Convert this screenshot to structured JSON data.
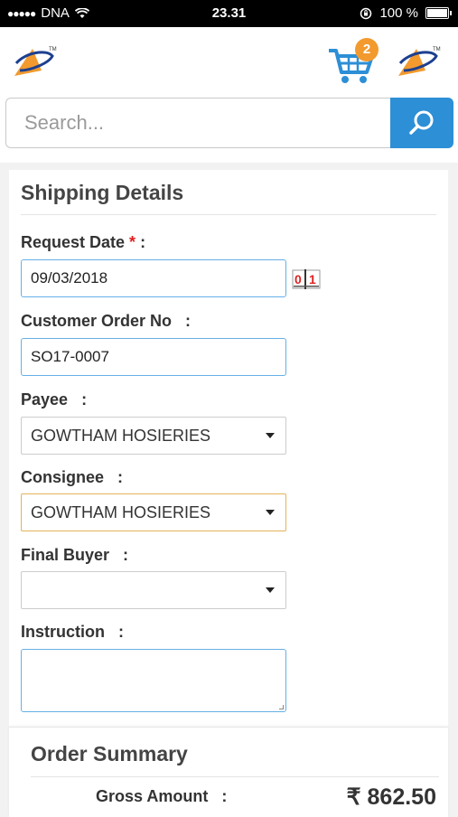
{
  "status_bar": {
    "carrier": "DNA",
    "time": "23.31",
    "battery": "100 %",
    "signal_icon": "signal-dots-icon",
    "wifi_icon": "wifi-icon",
    "lock_icon": "orientation-lock-icon",
    "battery_level": 1.0
  },
  "header": {
    "cart_count": "2",
    "cart_icon": "cart-icon",
    "brand_color": "#f29a2e",
    "cart_color": "#2d8fd6"
  },
  "search": {
    "placeholder": "Search...",
    "value": "",
    "button_icon": "search-icon",
    "button_color": "#2d8fd6"
  },
  "shipping": {
    "title": "Shipping Details",
    "request_date": {
      "label": "Request Date",
      "required_mark": "*",
      "colon": ":",
      "value": "09/03/2018",
      "calendar_icon": "calendar-icon"
    },
    "customer_order": {
      "label": "Customer Order No",
      "colon": ":",
      "value": "SO17-0007"
    },
    "payee": {
      "label": "Payee",
      "colon": ":",
      "selected": "GOWTHAM HOSIERIES"
    },
    "consignee": {
      "label": "Consignee",
      "colon": ":",
      "selected": "GOWTHAM HOSIERIES"
    },
    "final_buyer": {
      "label": "Final Buyer",
      "colon": ":",
      "selected": ""
    },
    "instruction": {
      "label": "Instruction",
      "colon": ":",
      "value": ""
    }
  },
  "summary": {
    "title": "Order Summary",
    "gross_label": "Gross Amount",
    "gross_colon": ":",
    "gross_value": "₹ 862.50"
  }
}
